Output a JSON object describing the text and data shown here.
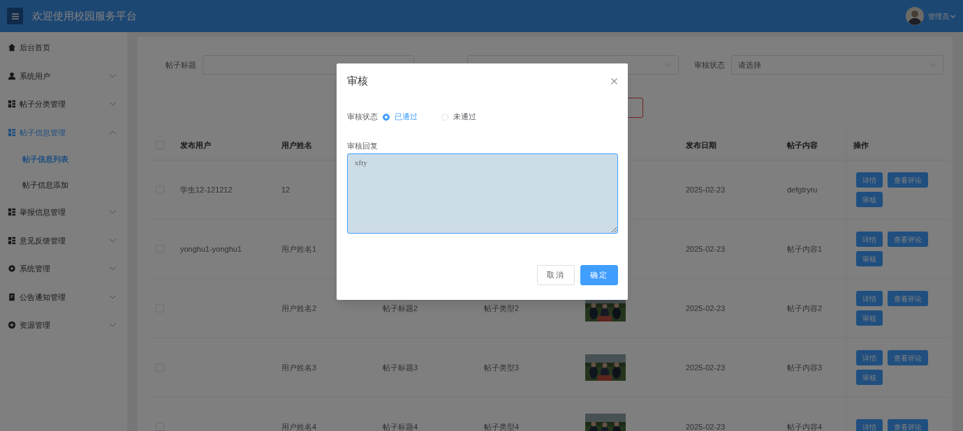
{
  "header": {
    "title": "欢迎使用校园服务平台",
    "user": "管理员"
  },
  "sidebar": {
    "items": [
      {
        "label": "后台首页",
        "kind": "link"
      },
      {
        "label": "系统用户",
        "kind": "menu",
        "expanded": false
      },
      {
        "label": "帖子分类管理",
        "kind": "menu",
        "expanded": false
      },
      {
        "label": "帖子信息管理",
        "kind": "menu",
        "expanded": true,
        "children": [
          {
            "label": "帖子信息列表",
            "selected": true
          },
          {
            "label": "帖子信息添加",
            "selected": false
          }
        ]
      },
      {
        "label": "举报信息管理",
        "kind": "menu",
        "expanded": false
      },
      {
        "label": "意见反馈管理",
        "kind": "menu",
        "expanded": false
      },
      {
        "label": "系统管理",
        "kind": "menu",
        "expanded": false
      },
      {
        "label": "公告通知管理",
        "kind": "menu",
        "expanded": false
      },
      {
        "label": "资源管理",
        "kind": "menu",
        "expanded": false
      }
    ]
  },
  "filters": [
    {
      "kind": "input",
      "label": "帖子标题"
    },
    {
      "kind": "select"
    },
    {
      "kind": "select",
      "label": "审核状态",
      "placeholder": "请选择"
    }
  ],
  "table": {
    "select_all": {
      "checked": false
    },
    "columns": [
      {
        "kind": "text",
        "label": "发布用户"
      },
      {
        "kind": "text",
        "label": "用户姓名"
      },
      {
        "kind": "text"
      },
      {
        "kind": "text"
      },
      {
        "kind": "text"
      },
      {
        "kind": "text",
        "label": "发布日期"
      },
      {
        "kind": "text",
        "label": "帖子内容"
      },
      {
        "kind": "actions",
        "label": "操作"
      }
    ],
    "rows": [
      {
        "checked": false,
        "cells": [
          "学生12-121212",
          "12",
          null,
          null,
          null,
          "2025-02-23",
          "defgtryru"
        ],
        "actions": [
          "详情",
          "查看评论",
          "审核"
        ]
      },
      {
        "checked": false,
        "cells": [
          "yonghu1-yonghu1",
          "用户姓名1",
          null,
          null,
          null,
          "2025-02-23",
          "帖子内容1"
        ],
        "actions": [
          "详情",
          "查看评论",
          "审核"
        ]
      },
      {
        "checked": false,
        "cells": [
          null,
          "用户姓名2",
          "帖子标题2",
          "帖子类型2",
          {
            "kind": "picture"
          },
          "2025-02-23",
          "帖子内容2"
        ],
        "actions": [
          "详情",
          "查看评论",
          "审核"
        ]
      },
      {
        "checked": false,
        "cells": [
          null,
          "用户姓名3",
          "帖子标题3",
          "帖子类型3",
          {
            "kind": "picture"
          },
          "2025-02-23",
          "帖子内容3"
        ],
        "actions": [
          "详情",
          "查看评论",
          "审核"
        ]
      },
      {
        "checked": false,
        "cells": [
          null,
          "用户姓名4",
          "帖子标题4",
          "帖子类型4",
          {
            "kind": "picture"
          },
          "2025-02-23",
          "帖子内容4"
        ],
        "actions": [
          "详情",
          "查看评论"
        ]
      }
    ]
  },
  "dialog": {
    "title": "审核",
    "fields": [
      {
        "kind": "radio",
        "label": "审核状态",
        "options": [
          {
            "label": "已通过",
            "selected": true
          },
          {
            "label": "未通过",
            "selected": false
          }
        ]
      },
      {
        "kind": "textarea",
        "label": "审核回复",
        "value": "xfty"
      }
    ],
    "buttons": [
      {
        "label": "取消",
        "primary": false
      },
      {
        "label": "确定",
        "primary": true
      }
    ]
  }
}
